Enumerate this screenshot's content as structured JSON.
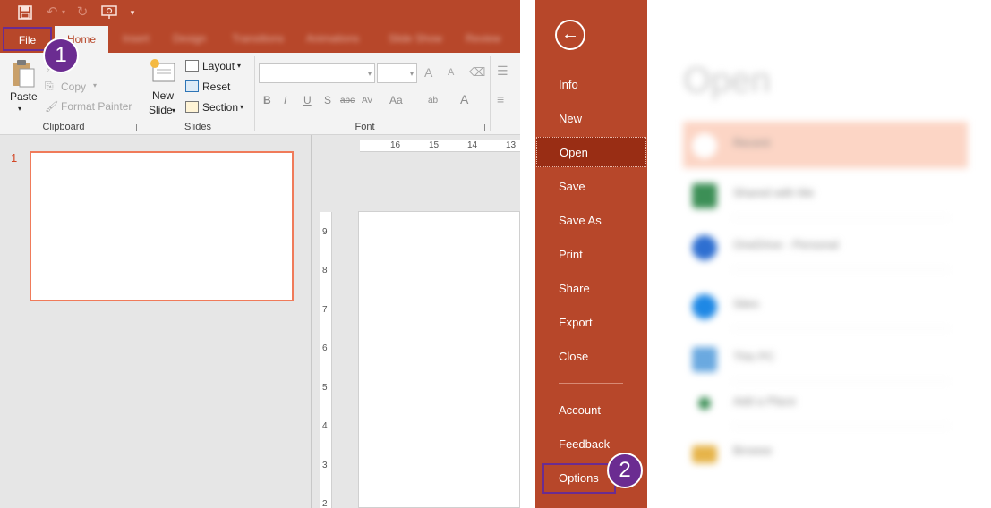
{
  "colors": {
    "accent": "#b7472a",
    "accent_dark": "#992d14",
    "callout": "#6b2c91",
    "thumb_border": "#f07b5a",
    "selected_place": "#fcd5c5"
  },
  "qat": {
    "icons": [
      "save-icon",
      "undo-icon",
      "redo-icon",
      "start-from-beginning-icon",
      "customize-qat-icon"
    ],
    "undo_glyph": "↶",
    "redo_glyph": "↻",
    "more_glyph": "▾"
  },
  "tabs": {
    "file": "File",
    "home": "Home",
    "blurred": [
      "Insert",
      "Design",
      "Transitions",
      "Animations",
      "Slide Show",
      "Review"
    ]
  },
  "ribbon": {
    "clipboard": {
      "paste": "Paste",
      "copy": "Copy",
      "format_painter": "Format Painter",
      "label": "Clipboard"
    },
    "slides": {
      "new_slide_1": "New",
      "new_slide_2": "Slide",
      "layout": "Layout",
      "reset": "Reset",
      "section": "Section",
      "label": "Slides"
    },
    "font": {
      "label": "Font",
      "bold": "B",
      "italic": "I",
      "underline": "U",
      "shadow": "S",
      "strike": "abc",
      "spacing": "AV",
      "case": "Aa",
      "highlight": "ab",
      "color": "A",
      "grow": "A",
      "shrink": "A"
    },
    "paragraph": {
      "bullets": "☰",
      "align": "≡"
    }
  },
  "slides_panel": {
    "slide_number": "1"
  },
  "rulers": {
    "horizontal": [
      "16",
      "15",
      "14",
      "13"
    ],
    "vertical": [
      "9",
      "8",
      "7",
      "6",
      "5",
      "4",
      "3",
      "2"
    ]
  },
  "callouts": {
    "first": "1",
    "second": "2"
  },
  "backstage": {
    "back_glyph": "←",
    "nav": [
      "Info",
      "New",
      "Open",
      "Save",
      "Save As",
      "Print",
      "Share",
      "Export",
      "Close",
      "Account",
      "Feedback",
      "Options"
    ],
    "active": "Open",
    "highlighted": "Options",
    "title": "Open",
    "places": [
      {
        "label": "Recent",
        "sub": "",
        "icon": "clock-icon",
        "color": "#ffffff"
      },
      {
        "label": "Shared with Me",
        "sub": "",
        "icon": "people-icon",
        "color": "#3c8f56"
      },
      {
        "label": "OneDrive - Personal",
        "sub": "",
        "icon": "cloud-icon",
        "color": "#2e6fd1"
      },
      {
        "label": "Sites",
        "sub": "",
        "icon": "sites-icon",
        "color": "#1e88e5"
      },
      {
        "label": "This PC",
        "sub": "",
        "icon": "computer-icon",
        "color": "#6aa9e0"
      },
      {
        "label": "Add a Place",
        "sub": "",
        "icon": "plus-icon",
        "color": "#3c8f56"
      },
      {
        "label": "Browse",
        "sub": "",
        "icon": "folder-icon",
        "color": "#e6b44a"
      }
    ]
  }
}
